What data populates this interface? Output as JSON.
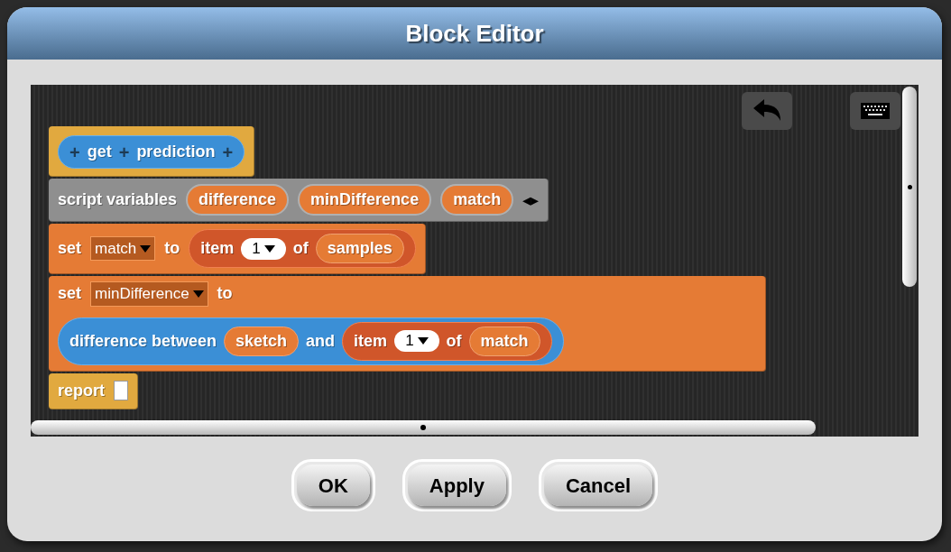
{
  "dialog": {
    "title": "Block Editor",
    "buttons": [
      "OK",
      "Apply",
      "Cancel"
    ]
  },
  "script": [
    {
      "kind": "hat",
      "parts": [
        {
          "kind": "prototype",
          "parts": [
            {
              "kind": "plus",
              "text": "+"
            },
            {
              "kind": "label",
              "text": "get"
            },
            {
              "kind": "plus",
              "text": "+"
            },
            {
              "kind": "label",
              "text": "prediction"
            },
            {
              "kind": "plus",
              "text": "+"
            }
          ]
        }
      ]
    },
    {
      "kind": "script_variables",
      "parts": [
        {
          "kind": "label",
          "text": "script variables"
        },
        {
          "kind": "upvar",
          "text": "difference"
        },
        {
          "kind": "upvar",
          "text": "minDifference"
        },
        {
          "kind": "upvar",
          "text": "match"
        },
        {
          "kind": "arrows",
          "text": "◂▸"
        }
      ]
    },
    {
      "kind": "set",
      "parts": [
        {
          "kind": "label",
          "text": "set"
        },
        {
          "kind": "dropdown",
          "text": "match"
        },
        {
          "kind": "label",
          "text": "to"
        },
        {
          "kind": "list",
          "parts": [
            {
              "kind": "label",
              "text": "item"
            },
            {
              "kind": "number",
              "text": "1"
            },
            {
              "kind": "label",
              "text": "of"
            },
            {
              "kind": "var",
              "text": "samples"
            }
          ]
        }
      ]
    },
    {
      "kind": "set",
      "parts": [
        {
          "kind": "label",
          "text": "set"
        },
        {
          "kind": "dropdown",
          "text": "minDifference"
        },
        {
          "kind": "label",
          "text": "to"
        },
        {
          "kind": "break"
        },
        {
          "kind": "custom",
          "parts": [
            {
              "kind": "label",
              "text": "difference between"
            },
            {
              "kind": "var",
              "text": "sketch"
            },
            {
              "kind": "label",
              "text": "and"
            },
            {
              "kind": "list",
              "parts": [
                {
                  "kind": "label",
                  "text": "item"
                },
                {
                  "kind": "number",
                  "text": "1"
                },
                {
                  "kind": "label",
                  "text": "of"
                },
                {
                  "kind": "var",
                  "text": "match"
                }
              ]
            }
          ]
        }
      ]
    },
    {
      "kind": "report",
      "parts": [
        {
          "kind": "label",
          "text": "report"
        },
        {
          "kind": "slot"
        }
      ]
    }
  ]
}
